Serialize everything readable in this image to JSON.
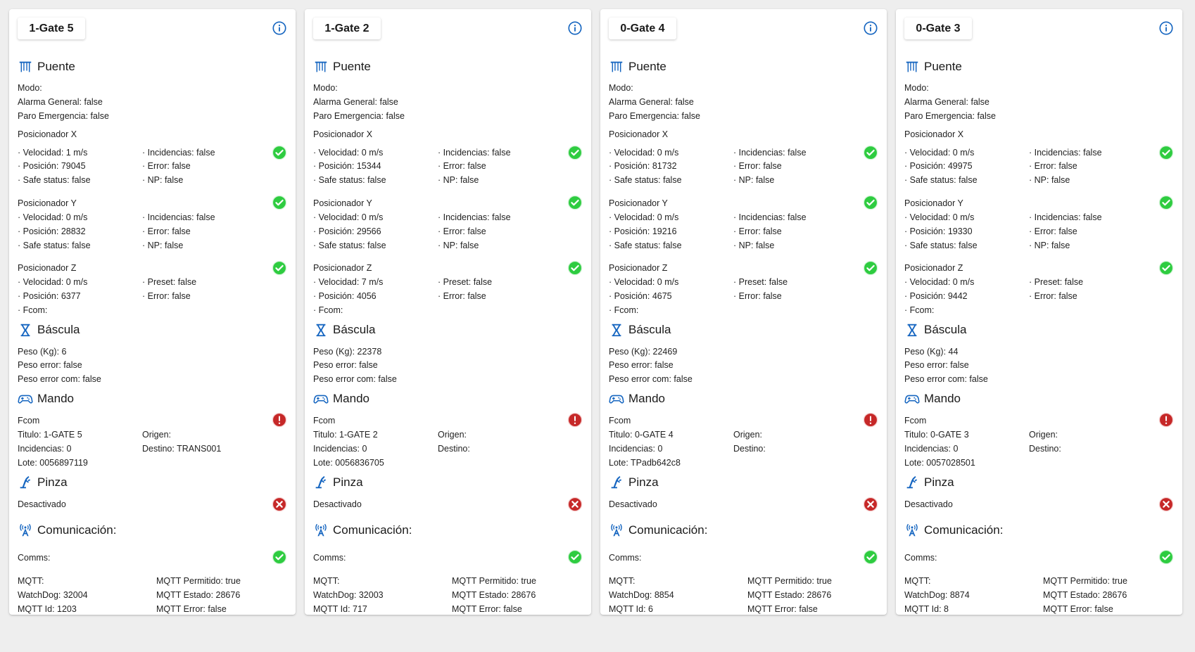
{
  "colors": {
    "ok": "#2ecc40",
    "error": "#c62828",
    "icon_blue": "#1565c0"
  },
  "labels": {
    "puente": "Puente",
    "modo": "Modo:",
    "posicionador_x": "Posicionador X",
    "posicionador_y": "Posicionador Y",
    "posicionador_z": "Posicionador Z",
    "bascula": "Báscula",
    "mando": "Mando",
    "fcom_header": "Fcom",
    "pinza": "Pinza",
    "comunicacion": "Comunicación:",
    "comms": "Comms:",
    "mqtt": "MQTT:",
    "fcom_line": "· Fcom:",
    "origen": "Origen:"
  },
  "cards": [
    {
      "gate": "1-Gate 5",
      "puente": {
        "alarma": "Alarma General: false",
        "paro": "Paro Emergencia: false"
      },
      "x": {
        "velocidad": "· Velocidad: 1 m/s",
        "posicion": "· Posición: 79045",
        "safe": "· Safe status: false",
        "incidencias": "· Incidencias: false",
        "error": "· Error: false",
        "np": "· NP: false",
        "status": "ok"
      },
      "y": {
        "velocidad": "· Velocidad: 0 m/s",
        "posicion": "· Posición: 28832",
        "safe": "· Safe status: false",
        "incidencias": "· Incidencias: false",
        "error": "· Error: false",
        "np": "· NP: false",
        "status": "ok"
      },
      "z": {
        "velocidad": "· Velocidad: 0 m/s",
        "posicion": "· Posición: 6377",
        "preset": "· Preset: false",
        "error": "· Error: false",
        "status": "ok"
      },
      "bascula": {
        "peso": "Peso (Kg): 6",
        "peso_error": "Peso error: false",
        "peso_error_com": "Peso error com: false"
      },
      "mando": {
        "titulo": "Titulo: 1-GATE 5",
        "incidencias": "Incidencias: 0",
        "lote": "Lote: 0056897119",
        "destino": "Destino: TRANS001",
        "status": "alert"
      },
      "pinza": {
        "estado": "Desactivado",
        "status": "error"
      },
      "comunicacion": {
        "watchdog": "WatchDog: 32004",
        "mqtt_id": "MQTT Id: 1203",
        "permitido": "MQTT Permitido: true",
        "estado": "MQTT Estado: 28676",
        "error": "MQTT Error: false",
        "status": "ok"
      }
    },
    {
      "gate": "1-Gate 2",
      "puente": {
        "alarma": "Alarma General: false",
        "paro": "Paro Emergencia: false"
      },
      "x": {
        "velocidad": "· Velocidad: 0 m/s",
        "posicion": "· Posición: 15344",
        "safe": "· Safe status: false",
        "incidencias": "· Incidencias: false",
        "error": "· Error: false",
        "np": "· NP: false",
        "status": "ok"
      },
      "y": {
        "velocidad": "· Velocidad: 0 m/s",
        "posicion": "· Posición: 29566",
        "safe": "· Safe status: false",
        "incidencias": "· Incidencias: false",
        "error": "· Error: false",
        "np": "· NP: false",
        "status": "ok"
      },
      "z": {
        "velocidad": "· Velocidad: 7 m/s",
        "posicion": "· Posición: 4056",
        "preset": "· Preset: false",
        "error": "· Error: false",
        "status": "ok"
      },
      "bascula": {
        "peso": "Peso (Kg): 22378",
        "peso_error": "Peso error: false",
        "peso_error_com": "Peso error com: false"
      },
      "mando": {
        "titulo": "Titulo: 1-GATE 2",
        "incidencias": "Incidencias: 0",
        "lote": "Lote: 0056836705",
        "destino": "Destino:",
        "status": "alert"
      },
      "pinza": {
        "estado": "Desactivado",
        "status": "error"
      },
      "comunicacion": {
        "watchdog": "WatchDog: 32003",
        "mqtt_id": "MQTT Id: 717",
        "permitido": "MQTT Permitido: true",
        "estado": "MQTT Estado: 28676",
        "error": "MQTT Error: false",
        "status": "ok"
      }
    },
    {
      "gate": "0-Gate 4",
      "puente": {
        "alarma": "Alarma General: false",
        "paro": "Paro Emergencia: false"
      },
      "x": {
        "velocidad": "· Velocidad: 0 m/s",
        "posicion": "· Posición: 81732",
        "safe": "· Safe status: false",
        "incidencias": "· Incidencias: false",
        "error": "· Error: false",
        "np": "· NP: false",
        "status": "ok"
      },
      "y": {
        "velocidad": "· Velocidad: 0 m/s",
        "posicion": "· Posición: 19216",
        "safe": "· Safe status: false",
        "incidencias": "· Incidencias: false",
        "error": "· Error: false",
        "np": "· NP: false",
        "status": "ok"
      },
      "z": {
        "velocidad": "· Velocidad: 0 m/s",
        "posicion": "· Posición: 4675",
        "preset": "· Preset: false",
        "error": "· Error: false",
        "status": "ok"
      },
      "bascula": {
        "peso": "Peso (Kg): 22469",
        "peso_error": "Peso error: false",
        "peso_error_com": "Peso error com: false"
      },
      "mando": {
        "titulo": "Titulo: 0-GATE 4",
        "incidencias": "Incidencias: 0",
        "lote": "Lote: TPadb642c8",
        "destino": "Destino:",
        "status": "alert"
      },
      "pinza": {
        "estado": "Desactivado",
        "status": "error"
      },
      "comunicacion": {
        "watchdog": "WatchDog: 8854",
        "mqtt_id": "MQTT Id: 6",
        "permitido": "MQTT Permitido: true",
        "estado": "MQTT Estado: 28676",
        "error": "MQTT Error: false",
        "status": "ok"
      }
    },
    {
      "gate": "0-Gate 3",
      "puente": {
        "alarma": "Alarma General: false",
        "paro": "Paro Emergencia: false"
      },
      "x": {
        "velocidad": "· Velocidad: 0 m/s",
        "posicion": "· Posición: 49975",
        "safe": "· Safe status: false",
        "incidencias": "· Incidencias: false",
        "error": "· Error: false",
        "np": "· NP: false",
        "status": "ok"
      },
      "y": {
        "velocidad": "· Velocidad: 0 m/s",
        "posicion": "· Posición: 19330",
        "safe": "· Safe status: false",
        "incidencias": "· Incidencias: false",
        "error": "· Error: false",
        "np": "· NP: false",
        "status": "ok"
      },
      "z": {
        "velocidad": "· Velocidad: 0 m/s",
        "posicion": "· Posición: 9442",
        "preset": "· Preset: false",
        "error": "· Error: false",
        "status": "ok"
      },
      "bascula": {
        "peso": "Peso (Kg): 44",
        "peso_error": "Peso error: false",
        "peso_error_com": "Peso error com: false"
      },
      "mando": {
        "titulo": "Titulo: 0-GATE 3",
        "incidencias": "Incidencias: 0",
        "lote": "Lote: 0057028501",
        "destino": "Destino:",
        "status": "alert"
      },
      "pinza": {
        "estado": "Desactivado",
        "status": "error"
      },
      "comunicacion": {
        "watchdog": "WatchDog: 8874",
        "mqtt_id": "MQTT Id: 8",
        "permitido": "MQTT Permitido: true",
        "estado": "MQTT Estado: 28676",
        "error": "MQTT Error: false",
        "status": "ok"
      }
    }
  ]
}
